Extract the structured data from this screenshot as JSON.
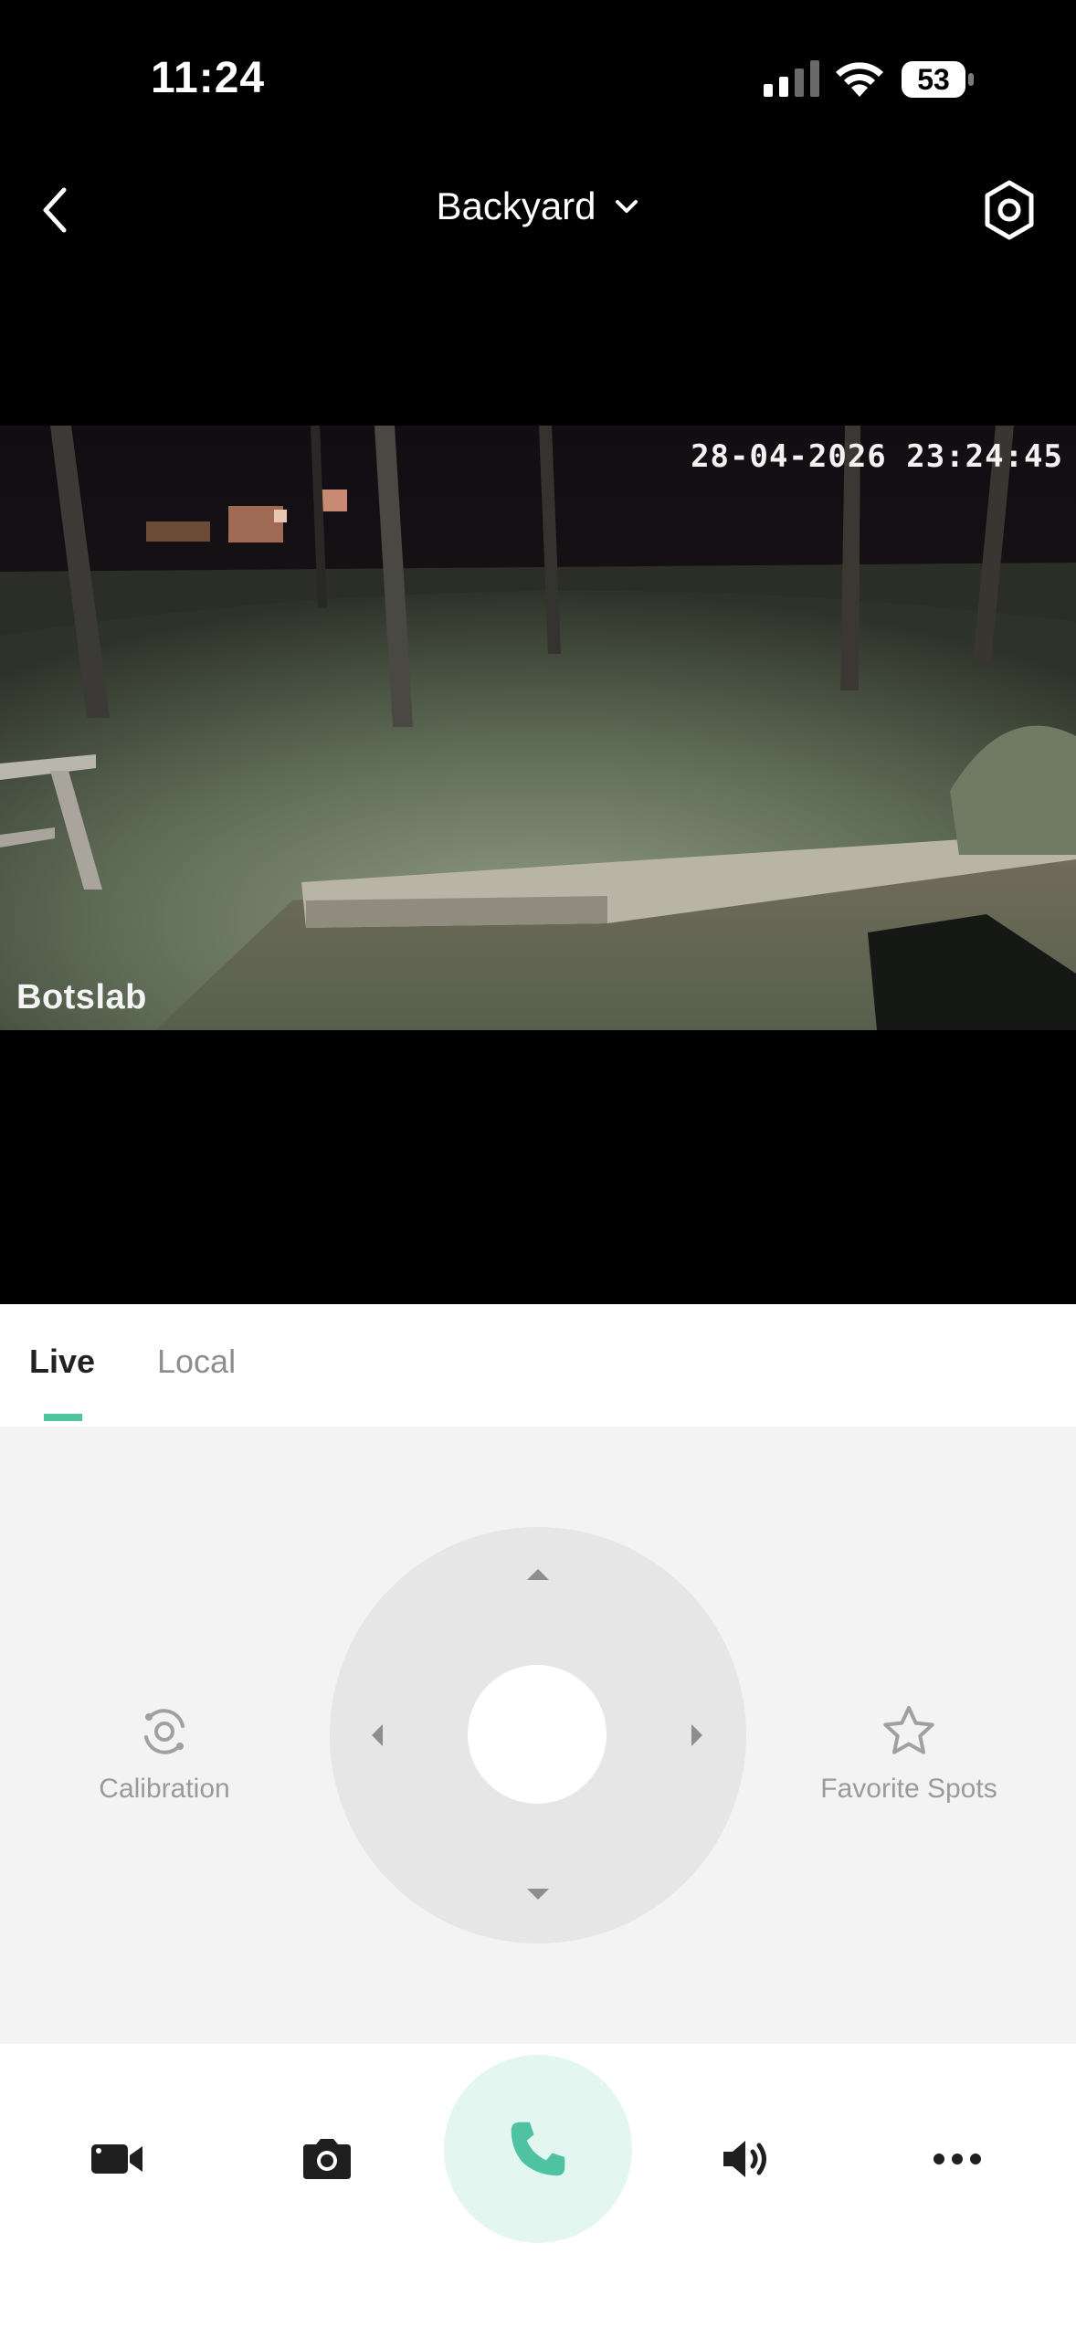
{
  "status_bar": {
    "time": "11:24",
    "battery": "53"
  },
  "header": {
    "camera_name": "Backyard"
  },
  "video": {
    "timestamp": "28-04-2026 23:24:45",
    "watermark": "Botslab"
  },
  "tabs": {
    "live": "Live",
    "local": "Local",
    "active": "Live"
  },
  "controls": {
    "calibration_label": "Calibration",
    "favorite_spots_label": "Favorite Spots"
  },
  "toolbar": {
    "items": [
      "record-video",
      "snapshot",
      "talk",
      "volume",
      "more"
    ]
  },
  "colors": {
    "accent": "#4fc3a1",
    "talk_bg": "#e4f6f0",
    "control_bg": "#f3f3f3",
    "joystick_bg": "#e6e6e6"
  }
}
